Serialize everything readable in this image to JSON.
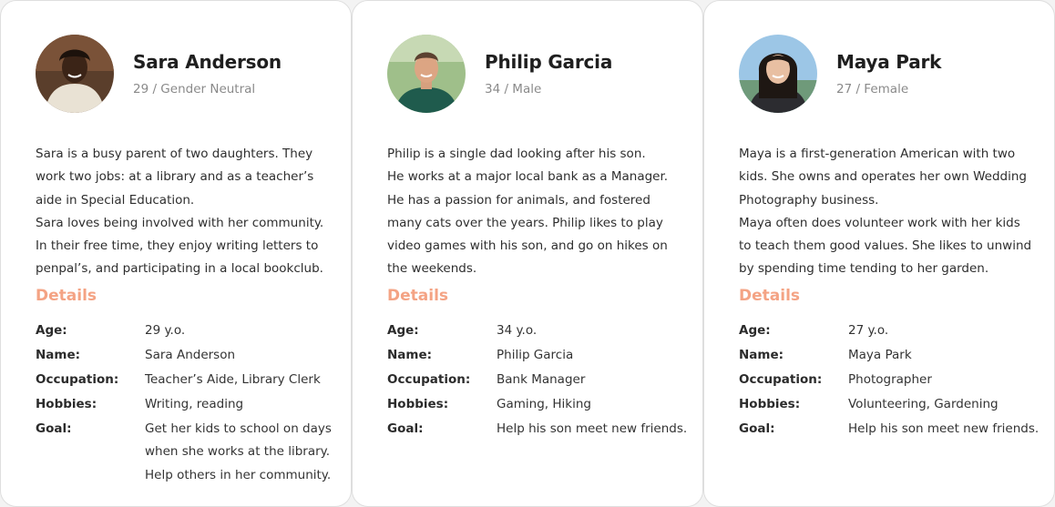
{
  "cards": [
    {
      "name": "Sara Anderson",
      "subtitle": "29 / Gender Neutral",
      "bio": [
        "Sara is a busy parent of two daughters. They",
        "work two jobs: at a library and as a teacher’s",
        "aide in Special Education.",
        "Sara loves being involved with her community.",
        "In their free time, they enjoy writing letters to",
        "penpal’s, and participating in a local bookclub."
      ],
      "details_title": "Details",
      "details": {
        "age_label": "Age:",
        "age": "29 y.o.",
        "name_label": "Name:",
        "name": "Sara Anderson",
        "occupation_label": "Occupation:",
        "occupation": "Teacher’s Aide, Library Clerk",
        "hobbies_label": "Hobbies:",
        "hobbies": "Writing, reading",
        "goal_label": "Goal:",
        "goal": [
          "Get her kids to school on days",
          "when she works at the library.",
          "Help others in her community."
        ]
      }
    },
    {
      "name": "Philip Garcia",
      "subtitle": "34 / Male",
      "bio": [
        "Philip is a single dad looking after his son.",
        "He works at a major local bank as a Manager.",
        "He has a passion for animals, and fostered",
        "many cats over the years. Philip likes to play",
        "video games with his son, and go on hikes on",
        "the weekends."
      ],
      "details_title": "Details",
      "details": {
        "age_label": "Age:",
        "age": "34 y.o.",
        "name_label": "Name:",
        "name": "Philip Garcia",
        "occupation_label": "Occupation:",
        "occupation": "Bank Manager",
        "hobbies_label": "Hobbies:",
        "hobbies": "Gaming, Hiking",
        "goal_label": "Goal:",
        "goal": [
          "Help his son meet new friends."
        ]
      }
    },
    {
      "name": "Maya Park",
      "subtitle": "27 / Female",
      "bio": [
        "Maya is a first-generation American with two",
        "kids. She owns and operates her own Wedding",
        "Photography business.",
        "Maya often does volunteer work with her kids",
        "to teach them good values. She likes to unwind",
        "by spending time tending to her garden."
      ],
      "details_title": "Details",
      "details": {
        "age_label": "Age:",
        "age": "27 y.o.",
        "name_label": "Name:",
        "name": "Maya Park",
        "occupation_label": "Occupation:",
        "occupation": "Photographer",
        "hobbies_label": "Hobbies:",
        "hobbies": "Volunteering, Gardening",
        "goal_label": "Goal:",
        "goal": [
          "Help his son meet new friends."
        ]
      }
    }
  ],
  "colors": {
    "accent": "#f4a384",
    "card_bg": "#ffffff",
    "page_bg": "#f3f3f3"
  }
}
